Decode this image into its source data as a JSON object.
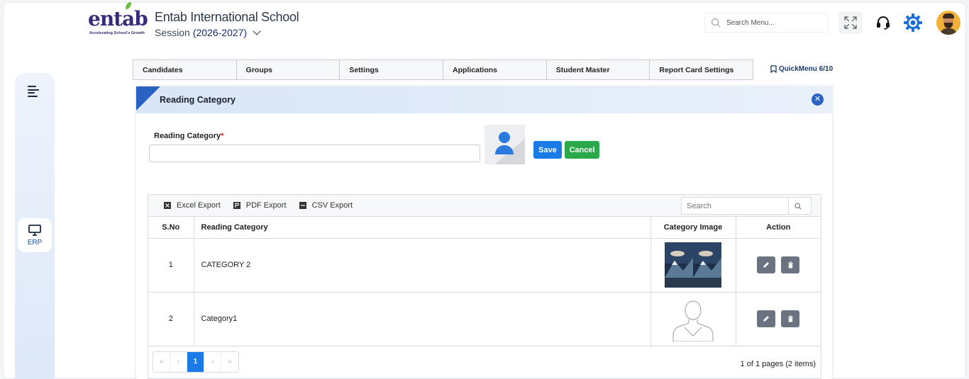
{
  "header": {
    "logo_text": "entab",
    "logo_tagline": "Accelerating School's Growth",
    "school_name": "Entab International School",
    "session_label": "Session",
    "session_year": "(2026-2027)",
    "search_placeholder": "Search Menu...",
    "icons": [
      "search-icon",
      "fullscreen-icon",
      "headset-icon",
      "gear-icon",
      "avatar"
    ]
  },
  "sidebar": {
    "items": [
      {
        "label": "",
        "icon": "menu-toggle-icon"
      },
      {
        "label": "ERP",
        "icon": "monitor-icon"
      }
    ]
  },
  "tabs": [
    "Candidates",
    "Groups",
    "Settings",
    "Applications",
    "Student Master",
    "Report Card Settings"
  ],
  "quickmenu": {
    "label": "QuickMenu 6/10",
    "icon": "bookmark-icon"
  },
  "panel": {
    "title": "Reading Category",
    "form": {
      "label": "Reading Category",
      "required_mark": "*",
      "value": "",
      "save_label": "Save",
      "cancel_label": "Cancel"
    },
    "toolbar": {
      "excel": "Excel Export",
      "pdf": "PDF Export",
      "csv": "CSV Export",
      "search_placeholder": "Search"
    },
    "columns": [
      "S.No",
      "Reading Category",
      "Category Image",
      "Action"
    ],
    "rows": [
      {
        "sno": "1",
        "category": "CATEGORY 2",
        "image": "mountain-photo"
      },
      {
        "sno": "2",
        "category": "Category1",
        "image": "person-outline"
      }
    ],
    "pager": {
      "first": "«",
      "prev": "‹",
      "current": "1",
      "next": "›",
      "last": "»",
      "info": "1 of 1 pages (2 items)"
    }
  },
  "colors": {
    "accent_blue": "#1a7ae6",
    "cancel_green": "#2aa84a",
    "panel_corner": "#2a62c4",
    "action_gray": "#6b7380"
  }
}
